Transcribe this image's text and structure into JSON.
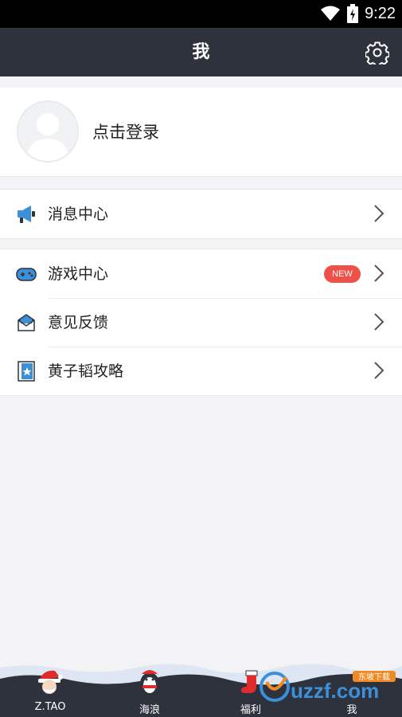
{
  "status_bar": {
    "time": "9:22"
  },
  "nav": {
    "title": "我"
  },
  "profile": {
    "login_label": "点击登录"
  },
  "menu_top": [
    {
      "label": "消息中心",
      "icon": "megaphone-icon"
    }
  ],
  "menu_main": [
    {
      "label": "游戏中心",
      "icon": "gamepad-icon",
      "badge": "NEW"
    },
    {
      "label": "意见反馈",
      "icon": "envelope-icon"
    },
    {
      "label": "黄子韬攻略",
      "icon": "book-star-icon"
    }
  ],
  "tabs": [
    {
      "label": "Z.TAO",
      "icon": "santa-icon"
    },
    {
      "label": "海浪",
      "icon": "penguin-icon"
    },
    {
      "label": "福利",
      "icon": "stocking-icon"
    },
    {
      "label": "我",
      "icon": "profile-icon"
    }
  ],
  "watermark": {
    "text": "uzzf.com",
    "sub": "东坡下载"
  },
  "colors": {
    "nav_bg": "#2d323c",
    "accent": "#3d8fd8",
    "badge": "#f0504a",
    "tabbar_bg": "#2d323c"
  }
}
